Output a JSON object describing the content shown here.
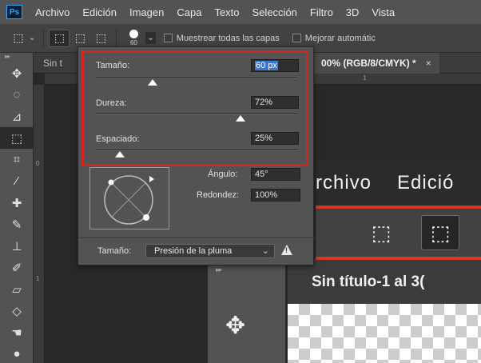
{
  "menubar": {
    "logo": "Ps",
    "items": [
      "Archivo",
      "Edición",
      "Imagen",
      "Capa",
      "Texto",
      "Selección",
      "Filtro",
      "3D",
      "Vista"
    ]
  },
  "options": {
    "brush_size_readout": "60",
    "sample_all_layers": "Muestrear todas las capas",
    "enhance_edge": "Mejorar automátic"
  },
  "tabs": {
    "tab1": "Sin t",
    "tab2": "00% (RGB/8/CMYK) *",
    "close": "×"
  },
  "rulers": {
    "h_tick": "1",
    "v_tick_0": "0",
    "v_tick_1": "1"
  },
  "brush_panel": {
    "size": {
      "label": "Tamaño:",
      "value": "60 px",
      "fraction": 0.28
    },
    "hardness": {
      "label": "Dureza:",
      "value": "72%",
      "fraction": 0.72
    },
    "spacing": {
      "label": "Espaciado:",
      "value": "25%",
      "fraction": 0.12
    },
    "angle": {
      "label": "Ángulo:",
      "value": "45°"
    },
    "roundness": {
      "label": "Redondez:",
      "value": "100%"
    },
    "size_control": {
      "label": "Tamaño:",
      "selected": "Presión de la pluma"
    }
  },
  "zoom_inset": {
    "menu": [
      "rchivo",
      "Edició"
    ],
    "title": "Sin título-1 al 3("
  },
  "colors": {
    "highlight": "#d22626",
    "inset_accent": "#d23a20",
    "selection": "#3a78d4"
  }
}
